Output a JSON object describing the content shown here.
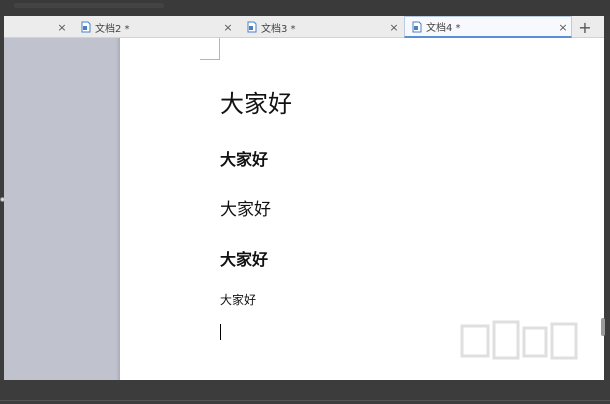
{
  "tabs": [
    {
      "label": "文档2 *",
      "active": false
    },
    {
      "label": "文档3 *",
      "active": false
    },
    {
      "label": "文档4 *",
      "active": true
    }
  ],
  "tab_close_glyph": "×",
  "new_tab_glyph": "+",
  "document": {
    "lines": [
      "大家好",
      "大家好",
      "大家好",
      "大家好",
      "大家好"
    ]
  },
  "colors": {
    "active_tab_underline": "#5a8fd6",
    "page_background": "#ffffff",
    "side_pane": "#c0c3ce",
    "frame": "#3c3c3c"
  },
  "icons": {
    "doc": "document-icon",
    "close": "close-icon",
    "add": "plus-icon"
  }
}
